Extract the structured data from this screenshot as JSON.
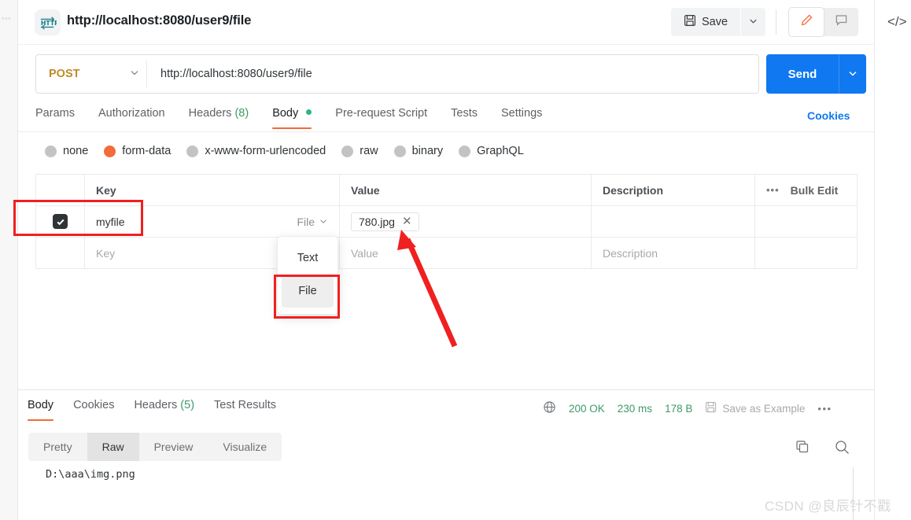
{
  "window": {
    "request_title": "http://localhost:8080/user9/file",
    "protocol_badge": "HTTP"
  },
  "toolbar": {
    "save_label": "Save",
    "save_caret_icon": "chevron-down-icon",
    "save_disk_icon": "floppy-disk-icon",
    "edit_icon": "pencil-icon",
    "comment_icon": "comment-icon",
    "code_icon": "</>"
  },
  "url_bar": {
    "method": "POST",
    "method_caret_icon": "chevron-down-icon",
    "url": "http://localhost:8080/user9/file",
    "send_label": "Send",
    "send_caret_icon": "chevron-down-icon"
  },
  "request_tabs": {
    "items": [
      {
        "label": "Params",
        "active": false
      },
      {
        "label": "Authorization",
        "active": false
      },
      {
        "label": "Headers",
        "count": "(8)",
        "active": false
      },
      {
        "label": "Body",
        "active": true,
        "dot": true
      },
      {
        "label": "Pre-request Script",
        "active": false
      },
      {
        "label": "Tests",
        "active": false
      },
      {
        "label": "Settings",
        "active": false
      }
    ],
    "cookies_link": "Cookies"
  },
  "body_types": {
    "options": [
      {
        "label": "none",
        "selected": false
      },
      {
        "label": "form-data",
        "selected": true
      },
      {
        "label": "x-www-form-urlencoded",
        "selected": false
      },
      {
        "label": "raw",
        "selected": false
      },
      {
        "label": "binary",
        "selected": false
      },
      {
        "label": "GraphQL",
        "selected": false
      }
    ],
    "selected_color": "#f26b3a"
  },
  "form_table": {
    "headers": {
      "key": "Key",
      "value": "Value",
      "description": "Description",
      "bulk_edit": "Bulk Edit",
      "more_icon": "ellipsis-icon"
    },
    "rows": [
      {
        "checked": true,
        "key": "myfile",
        "type": "File",
        "type_caret_icon": "chevron-down-icon",
        "value_file": "780.jpg",
        "value_clear_icon": "close-icon",
        "description": ""
      },
      {
        "checked": false,
        "key_placeholder": "Key",
        "value_placeholder": "Value",
        "description_placeholder": "Description"
      }
    ]
  },
  "type_dropdown": {
    "options": [
      {
        "label": "Text",
        "highlighted": false
      },
      {
        "label": "File",
        "highlighted": true
      }
    ]
  },
  "response": {
    "tabs": [
      {
        "label": "Body",
        "active": true
      },
      {
        "label": "Cookies",
        "active": false
      },
      {
        "label": "Headers",
        "count": "(5)",
        "active": false
      },
      {
        "label": "Test Results",
        "active": false
      }
    ],
    "globe_icon": "globe-icon",
    "status": "200 OK",
    "time": "230 ms",
    "size": "178 B",
    "save_example_label": "Save as Example",
    "save_example_icon": "floppy-disk-icon",
    "more_icon": "ellipsis-icon",
    "format_tabs": [
      {
        "label": "Pretty",
        "active": false
      },
      {
        "label": "Raw",
        "active": true
      },
      {
        "label": "Preview",
        "active": false
      },
      {
        "label": "Visualize",
        "active": false
      }
    ],
    "copy_icon": "copy-icon",
    "search_icon": "search-icon",
    "body_text": "D:\\aaa\\img.png"
  },
  "annotations": {
    "row_highlight_color": "#f02020",
    "dropdown_highlight_color": "#f02020",
    "arrow_color": "#f02020"
  },
  "watermark": "CSDN @良辰针不戳"
}
